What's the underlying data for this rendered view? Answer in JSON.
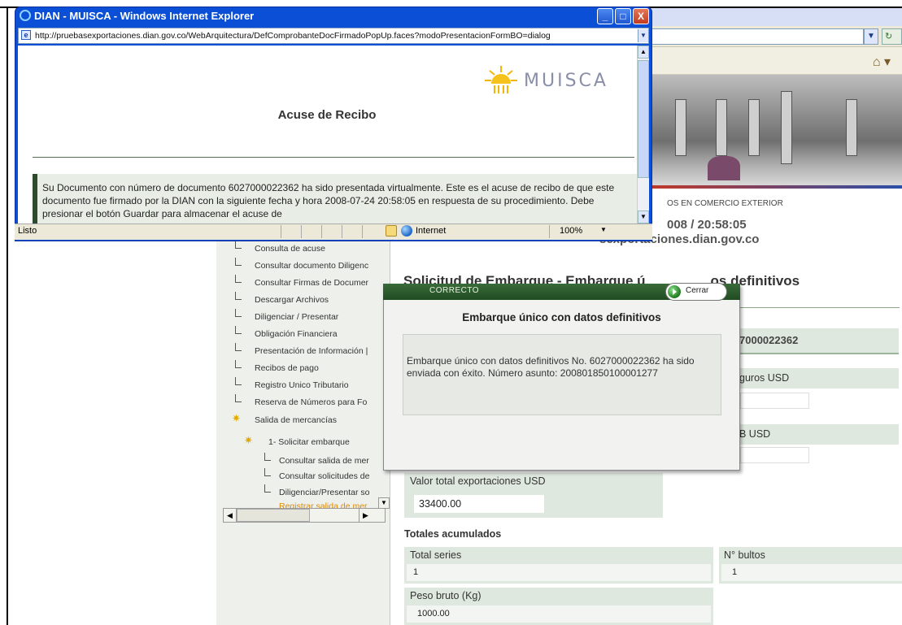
{
  "popup": {
    "title": "DIAN - MUISCA - Windows Internet Explorer",
    "url": "http://pruebasexportaciones.dian.gov.co/WebArquitectura/DefComprobanteDocFirmadoPopUp.faces?modoPresentacionFormBO=dialog",
    "logo_text": "MUISCA",
    "heading": "Acuse de Recibo",
    "message": "Su Documento con número de documento 6027000022362 ha sido presentada virtualmente. Este es el acuse de recibo de que este documento fue firmado por la DIAN con la siguiente fecha y hora 2008-07-24 20:58:05 en respuesta de su procedimiento. Debe presionar el botón Guardar para almacenar el acuse de",
    "status": {
      "text": "Listo",
      "zone": "Internet",
      "zoom": "100%"
    },
    "buttons": {
      "minimize": "_",
      "maximize": "□",
      "close": "X"
    }
  },
  "background": {
    "subtitle": "OS EN COMERCIO EXTERIOR",
    "datetime": "008 / 20:58:05",
    "domain": "sexportaciones.dian.gov.co"
  },
  "menu": {
    "items": [
      "Consulta de acuse",
      "Consultar documento Diligenc",
      "Consultar Firmas de Documer",
      "Descargar Archivos",
      "Diligenciar / Presentar",
      "Obligación Financiera",
      "Presentación de Información |",
      "Recibos de pago",
      "Registro Unico Tributario",
      "Reserva de Números para Fo"
    ],
    "salida": "Salida de mercancías",
    "solicitar": "1- Solicitar embarque",
    "subitems": [
      "Consultar salida de mer",
      "Consultar solicitudes de",
      "Diligenciar/Presentar so",
      "Registrar salida de mer"
    ]
  },
  "form": {
    "title_left": "Solicitud de Embarque - Embarque ú",
    "title_right": "os definitivos",
    "docnum": "7000022362",
    "seguros_label": "guros USD",
    "fob_label": "B USD",
    "valor_total_label": "Valor total exportaciones USD",
    "valor_total_value": "33400.00",
    "totales_heading": "Totales acumulados",
    "total_series_label": "Total series",
    "total_series_value": "1",
    "bultos_label": "N° bultos",
    "bultos_value": "1",
    "peso_label": "Peso bruto (Kg)",
    "peso_value": "1000.00"
  },
  "modal": {
    "status_label": "CORRECTO",
    "close_label": "Cerrar",
    "title": "Embarque único con datos definitivos",
    "message": "Embarque único con datos definitivos No. 6027000022362 ha sido enviada con éxito. Número asunto: 200801850100001277"
  },
  "colors": {
    "xp_title_blue": "#0a4fd6",
    "modal_header_green": "#1f4c21",
    "form_label_green": "#dfe8de"
  }
}
